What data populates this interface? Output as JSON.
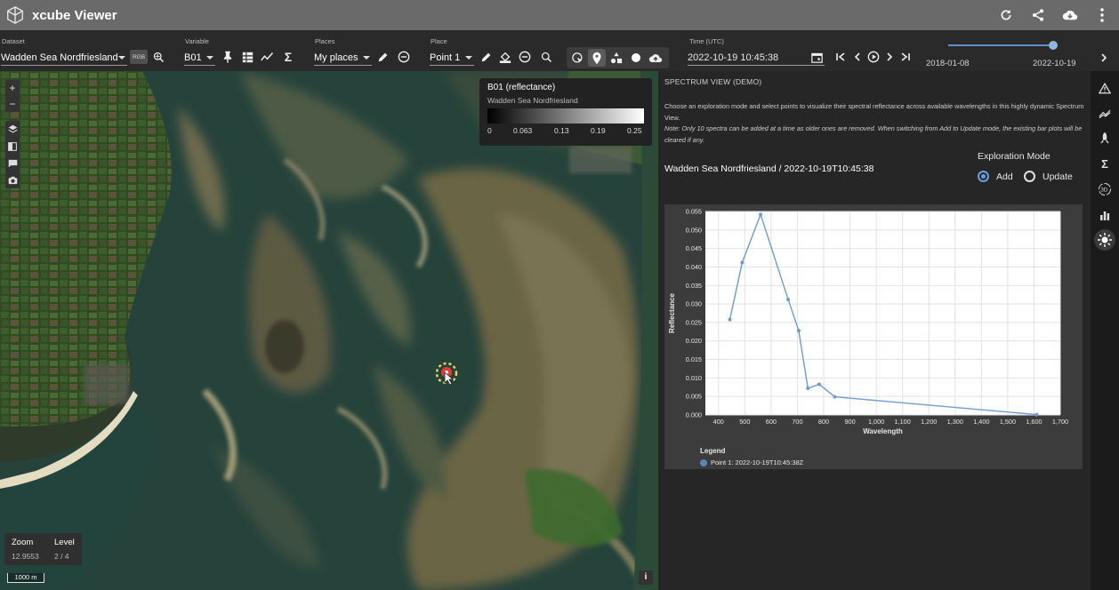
{
  "app": {
    "title": "xcube Viewer"
  },
  "controls": {
    "dataset_label": "Dataset",
    "dataset_value": "Wadden Sea Nordfriesland",
    "rgb_label": "RGB",
    "variable_label": "Variable",
    "variable_value": "B01",
    "places_label": "Places",
    "places_value": "My places",
    "place_label": "Place",
    "place_value": "Point 1",
    "time_label": "Time (UTC)",
    "time_value": "2022-10-19 10:45:38",
    "range_start": "2018-01-08",
    "range_end": "2022-10-19"
  },
  "map": {
    "legend_title": "B01 (reflectance)",
    "legend_subtitle": "Wadden Sea Nordfriesland",
    "legend_ticks": [
      "0",
      "0.063",
      "0.13",
      "0.19",
      "0.25"
    ],
    "zoom_label": "Zoom",
    "zoom_value": "12.9553",
    "level_label": "Level",
    "level_value": "2 / 4",
    "scale_label": "1000 m",
    "info_label": "i",
    "zoom_in": "+",
    "zoom_out": "−"
  },
  "panel": {
    "header": "SPECTRUM VIEW (DEMO)",
    "desc1": "Choose an exploration mode and select points to visualize their spectral reflectance across available wavelengths in this highly dynamic Spectrum View.",
    "desc2": "Note: Only 10 spectra can be added at a time as older ones are removed. When switching from Add to Update mode, the existing bar plots will be cleared if any.",
    "dataset_time": "Wadden Sea Nordfriesland / 2022-10-19T10:45:38",
    "mode_title": "Exploration Mode",
    "mode_add": "Add",
    "mode_update": "Update",
    "selected_mode": "Add",
    "legend_title": "Legend",
    "legend_entry": "Point 1: 2022-10-19T10:45:38Z"
  },
  "chart_data": {
    "type": "line",
    "xlabel": "Wavelength",
    "ylabel": "Reflectance",
    "xlim": [
      350,
      1700
    ],
    "ylim": [
      0,
      0.055
    ],
    "x_ticks": [
      400,
      500,
      600,
      700,
      800,
      900,
      1000,
      1100,
      1200,
      1300,
      1400,
      1500,
      1600,
      1700
    ],
    "x_tick_labels": [
      "400",
      "500",
      "600",
      "700",
      "800",
      "900",
      "1,000",
      "1,100",
      "1,200",
      "1,300",
      "1,400",
      "1,500",
      "1,600",
      "1,700"
    ],
    "y_ticks": [
      0,
      0.005,
      0.01,
      0.015,
      0.02,
      0.025,
      0.03,
      0.035,
      0.04,
      0.045,
      0.05,
      0.055
    ],
    "y_tick_labels": [
      "0.000",
      "0.005",
      "0.010",
      "0.015",
      "0.020",
      "0.025",
      "0.030",
      "0.035",
      "0.040",
      "0.045",
      "0.050",
      "0.055"
    ],
    "grid": true,
    "series": [
      {
        "name": "Point 1: 2022-10-19T10:45:38Z",
        "color": "#6f9bd1",
        "x": [
          443,
          490,
          560,
          665,
          705,
          740,
          783,
          842,
          1610
        ],
        "y": [
          0.0258,
          0.0412,
          0.0542,
          0.0312,
          0.0228,
          0.0072,
          0.0083,
          0.0049,
          0.0001
        ]
      }
    ]
  },
  "colors": {
    "accent": "#5e8fc7",
    "appbar": "#6a6a6a"
  }
}
